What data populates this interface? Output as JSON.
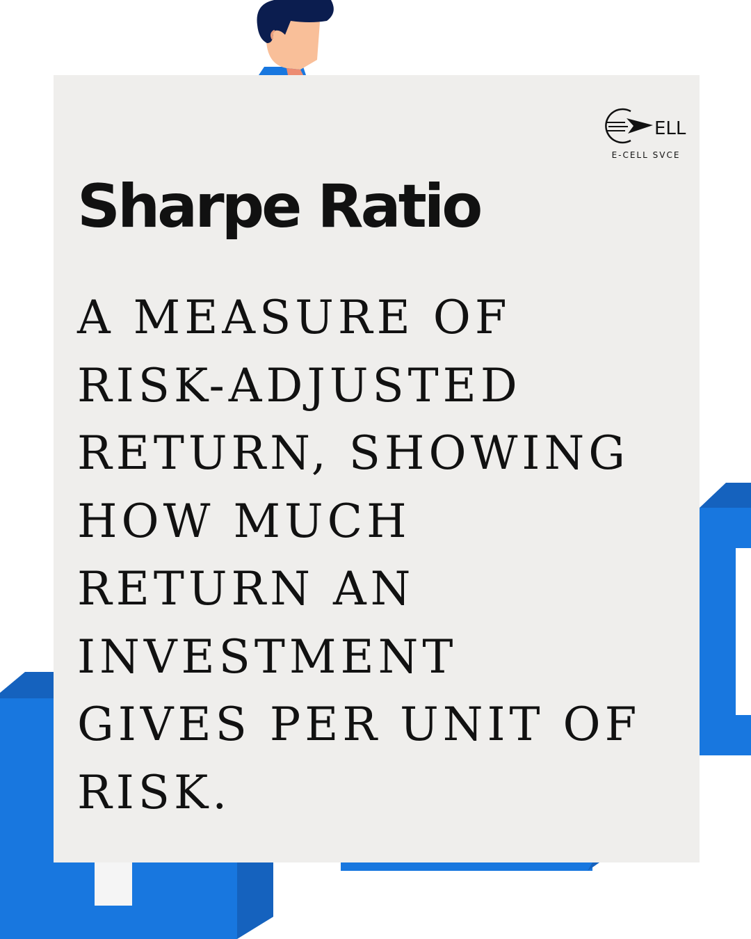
{
  "logo": {
    "caption": "E-CELL SVCE",
    "mark_text": "ELL"
  },
  "title": "Sharpe Ratio",
  "definition_lines": [
    "A MEASURE OF",
    "RISK-ADJUSTED",
    "RETURN, SHOWING",
    "HOW MUCH",
    "RETURN AN",
    "INVESTMENT",
    "GIVES PER UNIT OF",
    "RISK."
  ],
  "colors": {
    "background": "#ffffff",
    "card": "#efeeec",
    "block_blue": "#1877df",
    "block_blue_dark": "#1562be",
    "text": "#111111",
    "hair": "#0b1d4f",
    "skin": "#f9bf99"
  }
}
